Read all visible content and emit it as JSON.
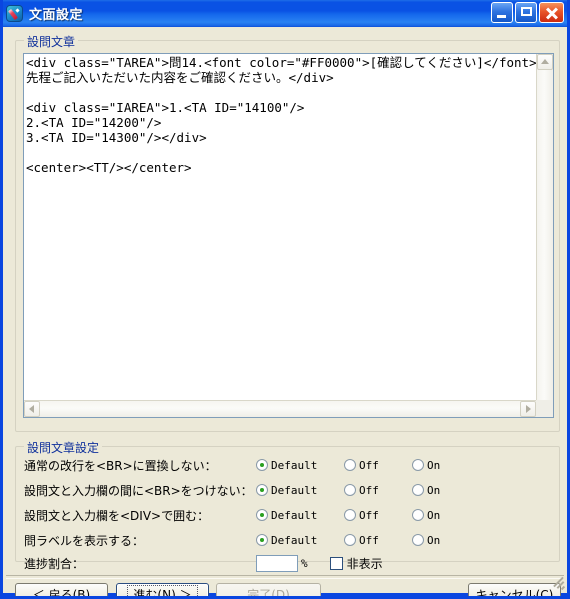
{
  "window": {
    "title": "文面設定",
    "icon": "pencil-icon",
    "controls": {
      "minimize": "minimize-icon",
      "maximize": "maximize-icon",
      "close": "close-icon"
    }
  },
  "text_group": {
    "legend": "設問文章",
    "content": "<div class=\"TAREA\">問14.<font color=\"#FF0000\">[確認してください]</font>\n先程ご記入いただいた内容をご確認ください。</div>\n\n<div class=\"IAREA\">1.<TA ID=\"14100\"/>\n2.<TA ID=\"14200\"/>\n3.<TA ID=\"14300\"/></div>\n\n<center><TT/></center>",
    "scrollbars": {
      "up_arrow": "scroll-up-icon",
      "left_arrow": "scroll-left-icon",
      "right_arrow": "scroll-right-icon"
    }
  },
  "settings_group": {
    "legend": "設問文章設定",
    "radio_options": [
      "Default",
      "Off",
      "On"
    ],
    "rows": [
      {
        "label": "通常の改行を<BR>に置換しない：",
        "selected": "Default"
      },
      {
        "label": "設問文と入力欄の間に<BR>をつけない：",
        "selected": "Default"
      },
      {
        "label": "設問文と入力欄を<DIV>で囲む：",
        "selected": "Default"
      },
      {
        "label": "問ラベルを表示する：",
        "selected": "Default"
      }
    ],
    "progress_row": {
      "label": "進捗割合：",
      "value": "",
      "placeholder": "",
      "unit": "%",
      "checkbox_label": "非表示",
      "checked": false
    }
  },
  "buttons": {
    "back": "＜ 戻る(B)",
    "next": "進む(N) ＞",
    "finish": "完了(D)",
    "cancel": "キャンセル(C)"
  }
}
